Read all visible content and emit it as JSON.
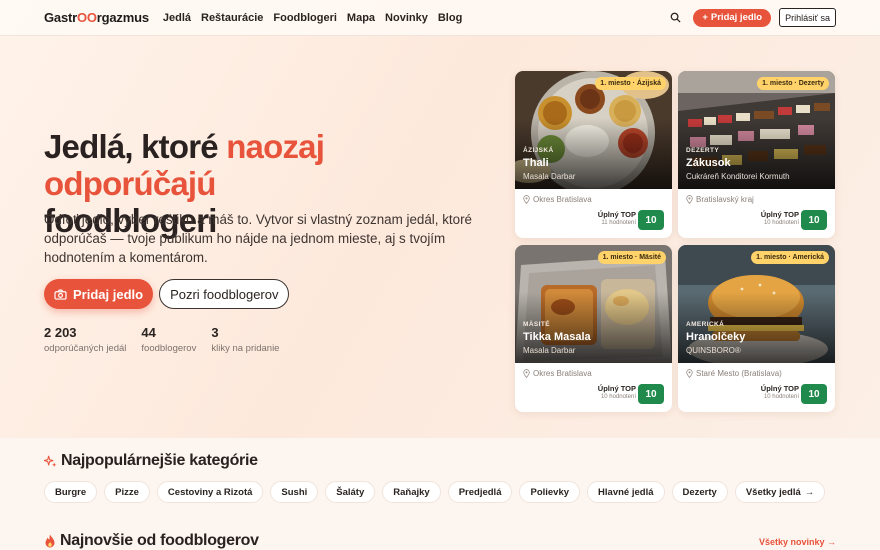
{
  "nav": {
    "logo_pre": "Gastr",
    "logo_oo": "OO",
    "logo_post": "rgazmus",
    "links": [
      "Jedlá",
      "Reštaurácie",
      "Foodblogeri",
      "Mapa",
      "Novinky",
      "Blog"
    ],
    "add_label": "Pridaj jedlo",
    "login_label": "Prihlásiť sa"
  },
  "hero": {
    "title_part1": "Jedlá, ktoré ",
    "title_accent": "naozaj odporúčajú",
    "title_part2": "foodblogeri",
    "description": "Odfoť jedlo, vyber reštiku a máš to. Vytvor si vlastný zoznam jedál, ktoré odporúčaš — tvoje publikum ho nájde na jednom mieste, aj s tvojím hodnotením a komentárom.",
    "cta_primary": "Pridaj jedlo",
    "cta_secondary": "Pozri foodblogerov",
    "stats": [
      {
        "value": "2 203",
        "label": "odporúčaných jedál"
      },
      {
        "value": "44",
        "label": "foodblogerov"
      },
      {
        "value": "3",
        "label": "kliky na pridanie"
      }
    ]
  },
  "cards": [
    {
      "rank": "1. miesto · Ázijská",
      "category": "ÁZIJSKÁ",
      "title": "Thali",
      "place": "Masala Darbar",
      "location": "Okres Bratislava",
      "rating_label": "Úplný TOP",
      "rating_count": "11 hodnotení",
      "score": "10"
    },
    {
      "rank": "1. miesto · Dezerty",
      "category": "DEZERTY",
      "title": "Zákusok",
      "place": "Cukráreň Konditorei Kormuth",
      "location": "Bratislavský kraj",
      "rating_label": "Úplný TOP",
      "rating_count": "10 hodnotení",
      "score": "10"
    },
    {
      "rank": "1. miesto · Mäsité",
      "category": "MÄSITÉ",
      "title": "Tikka Masala",
      "place": "Masala Darbar",
      "location": "Okres Bratislava",
      "rating_label": "Úplný TOP",
      "rating_count": "10 hodnotení",
      "score": "10"
    },
    {
      "rank": "1. miesto · Americká",
      "category": "AMERICKÁ",
      "title": "Hranolčeky",
      "place": "QUINSBORO®",
      "location": "Staré Mesto (Bratislava)",
      "rating_label": "Úplný TOP",
      "rating_count": "10 hodnotení",
      "score": "10"
    }
  ],
  "categories": {
    "title": "Najpopulárnejšie kategórie",
    "items": [
      "Burgre",
      "Pizze",
      "Cestoviny a Rizotá",
      "Sushi",
      "Šaláty",
      "Raňajky",
      "Predjedlá",
      "Polievky",
      "Hlavné jedlá",
      "Dezerty"
    ],
    "all_label": "Všetky jedlá"
  },
  "news": {
    "title": "Najnovšie od foodblogerov",
    "all_label": "Všetky novinky"
  },
  "colors": {
    "accent": "#e8533b",
    "score": "#1f8a4c",
    "rank_badge": "#ffd36a"
  }
}
